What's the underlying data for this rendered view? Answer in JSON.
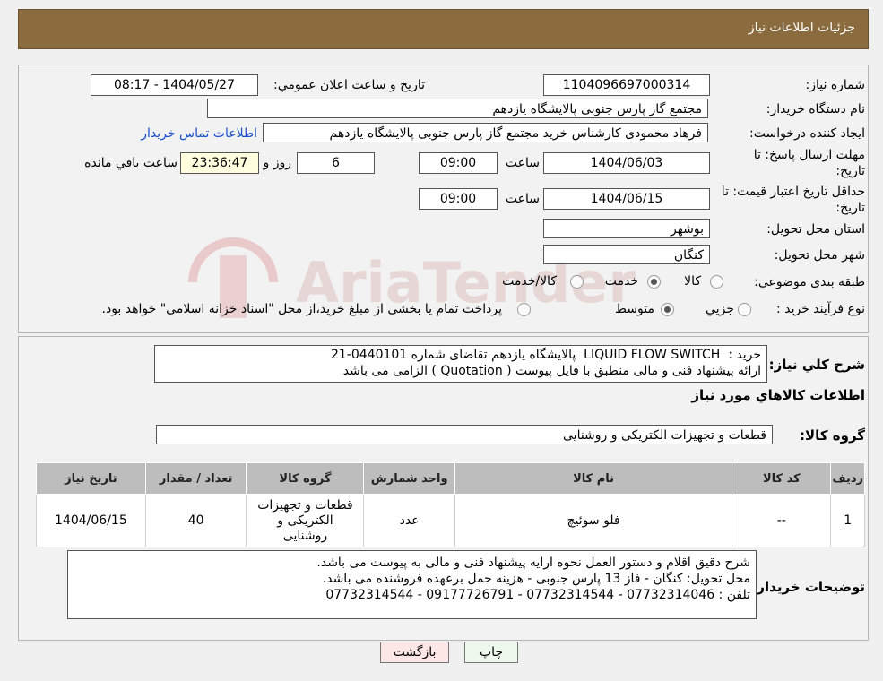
{
  "header": {
    "title": "جزئیات اطلاعات نیاز"
  },
  "form": {
    "need_number_label": "شماره نیاز:",
    "need_number": "1104096697000314",
    "announce_label": "تاریخ و ساعت اعلان عمومي:",
    "announce_value": "1404/05/27 - 08:17",
    "buyer_label": "نام دستگاه خريدار:",
    "buyer_value": "مجتمع گاز پارس جنوبی  پالایشگاه یازدهم",
    "creator_label": "ايجاد كننده درخواست:",
    "creator_value": "فرهاد محمودی کارشناس خرید مجتمع گاز پارس جنوبی  پالایشگاه یازدهم",
    "contact_link": "اطلاعات تماس خریدار",
    "deadline_label_1": "مهلت ارسال پاسخ: تا",
    "deadline_label_2": "تاريخ:",
    "deadline_date": "1404/06/03",
    "time_label": "ساعت",
    "deadline_time": "09:00",
    "days_value": "6",
    "days_label": "روز و",
    "remaining_value": "23:36:47",
    "remaining_label": "ساعت باقي مانده",
    "validity_label_1": "حداقل تاريخ اعتبار قيمت: تا",
    "validity_label_2": "تاريخ:",
    "validity_date": "1404/06/15",
    "validity_time": "09:00",
    "province_label": "استان محل تحويل:",
    "province_value": "بوشهر",
    "city_label": "شهر محل تحويل:",
    "city_value": "کنگان",
    "category_label": "طبقه بندی موضوعی:",
    "cat_goods": "كالا",
    "cat_service": "خدمت",
    "cat_both": "كالا/خدمت",
    "process_label": "نوع فرآيند خريد :",
    "proc_partial": "جزيي",
    "proc_medium": "متوسط",
    "proc_note": "پرداخت تمام يا بخشی از مبلغ خريد،از محل \"اسناد خزانه اسلامی\" خواهد بود."
  },
  "summary": {
    "label": "شرح كلي نياز:",
    "text": "خرید :  LIQUID FLOW SWITCH  پالایشگاه یازدهم تقاضای شماره 0440101-21\nارائه پیشنهاد فنی و مالی منطبق با فایل پیوست ( Quotation ) الزامی می باشد"
  },
  "goods_info_title": "اطلاعات كالاهاي مورد نياز",
  "goods_group": {
    "label": "گروه كالا:",
    "value": "قطعات و تجهیزات الکتریکی و روشنایی"
  },
  "table": {
    "headers": {
      "row": "رديف",
      "code": "كد كالا",
      "name": "نام كالا",
      "unit": "واحد شمارش",
      "group": "گروه كالا",
      "qty": "تعداد / مقدار",
      "date": "تاريخ نياز"
    },
    "rows": [
      {
        "row": "1",
        "code": "--",
        "name": "فلو سوئیچ",
        "unit": "عدد",
        "group": "قطعات و تجهیزات الکتریکی و روشنایی",
        "qty": "40",
        "date": "1404/06/15"
      }
    ]
  },
  "buyer_notes": {
    "label": "توضيحات خريدار:",
    "text": "شرح دقیق اقلام و دستور العمل نحوه ارایه پیشنهاد فنی و مالی به پیوست می باشد.\nمحل تحویل: کنگان - فاز 13 پارس جنوبی - هزینه حمل برعهده فروشنده می باشد.\nتلفن : 07732314046 - 07732314544 - 09177726791 - 07732314544"
  },
  "buttons": {
    "print": "چاپ",
    "back": "بازگشت"
  },
  "watermark": "AriaTender.net"
}
